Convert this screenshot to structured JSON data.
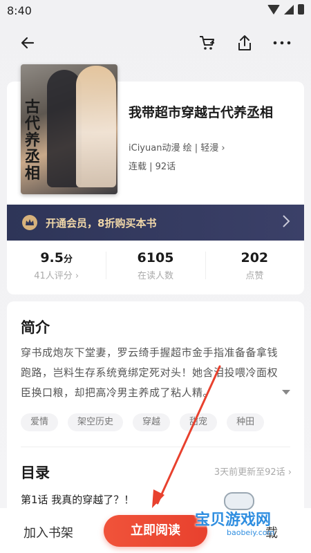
{
  "status_bar": {
    "time": "8:40"
  },
  "book": {
    "cover_title": "古代养丞相",
    "title": "我带超市穿越古代养丞相",
    "author_line": "iCiyuan动漫 绘 | 轻漫 ›",
    "status_line": "连载 | 92话"
  },
  "vip": {
    "text": "开通会员，8折购买本书"
  },
  "stats": [
    {
      "value": "9.5",
      "unit": "分",
      "label": "41人评分 ›"
    },
    {
      "value": "6105",
      "unit": "",
      "label": "在读人数"
    },
    {
      "value": "202",
      "unit": "",
      "label": "点赞"
    }
  ],
  "intro": {
    "title": "简介",
    "body": "穿书成炮灰下堂妻，罗云绮手握超市金手指准备备拿钱跑路，岂料生存系统竟绑定死对头！她含泪投喂冷面权臣换口粮，却把高冷男主养成了粘人精。"
  },
  "tags": [
    "爱情",
    "架空历史",
    "穿越",
    "甜宠",
    "种田"
  ],
  "catalog": {
    "title": "目录",
    "update": "3天前更新至92话 ›",
    "first_chapter": "第1话 我真的穿越了？！"
  },
  "bottom_bar": {
    "add_shelf": "加入书架",
    "read_now": "立即阅读",
    "download": "载"
  },
  "watermark": {
    "main": "宝贝游戏网",
    "sub": "baobeiy.com"
  },
  "colors": {
    "accent": "#e8412e",
    "vip_bg": "#2e3558",
    "vip_text": "#f0d7a8",
    "watermark": "#2f8ee0"
  }
}
